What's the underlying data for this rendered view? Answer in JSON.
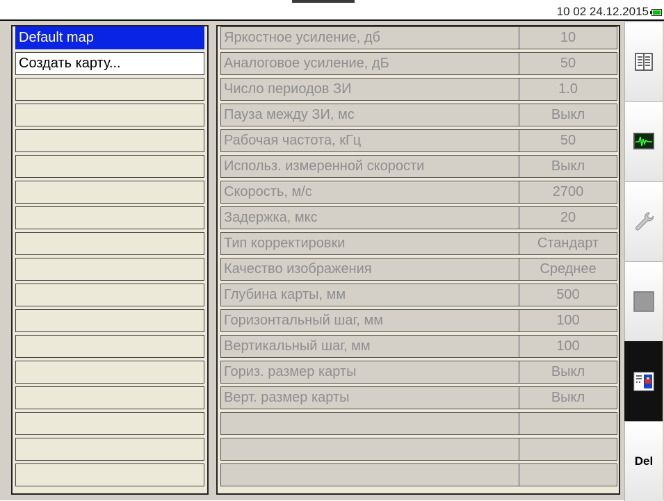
{
  "status": {
    "datetime": "10 02 24.12.2015",
    "battery_color": "#00c000"
  },
  "maps": {
    "items": [
      "Default map",
      "Создать карту..."
    ],
    "selected_index": 0,
    "empty_row_count": 16
  },
  "params": {
    "rows": [
      {
        "name": "Яркостное усиление, дб",
        "value": "10"
      },
      {
        "name": "Аналоговое усиление, дБ",
        "value": "50"
      },
      {
        "name": "Число периодов ЗИ",
        "value": "1.0"
      },
      {
        "name": "Пауза между ЗИ, мс",
        "value": "Выкл"
      },
      {
        "name": "Рабочая частота, кГц",
        "value": "50"
      },
      {
        "name": "Использ. измеренной скорости",
        "value": "Выкл"
      },
      {
        "name": "Скорость, м/с",
        "value": "2700"
      },
      {
        "name": "Задержка, мкс",
        "value": "20"
      },
      {
        "name": "Тип корректировки",
        "value": "Стандарт"
      },
      {
        "name": "Качество изображения",
        "value": "Среднее"
      },
      {
        "name": "Глубина карты, мм",
        "value": "500"
      },
      {
        "name": "Горизонтальный шаг, мм",
        "value": "100"
      },
      {
        "name": "Вертикальный шаг, мм",
        "value": "100"
      },
      {
        "name": "Гориз. размер карты",
        "value": "Выкл"
      },
      {
        "name": "Верт. размер карты",
        "value": "Выкл"
      },
      {
        "name": "",
        "value": ""
      },
      {
        "name": "",
        "value": ""
      },
      {
        "name": "",
        "value": ""
      }
    ],
    "text_color": "#8e8e8e"
  },
  "sidebar": {
    "buttons": [
      {
        "icon": "list-icon"
      },
      {
        "icon": "waveform-monitor-icon"
      },
      {
        "icon": "wrench-icon"
      },
      {
        "icon": "gray-square-icon"
      },
      {
        "icon": "map-view-icon",
        "active": true
      },
      {
        "icon": "",
        "label": "Del"
      }
    ]
  },
  "colors": {
    "selection": "#0a24e6",
    "panel": "#d4d0c8",
    "active_button": "#111111"
  }
}
